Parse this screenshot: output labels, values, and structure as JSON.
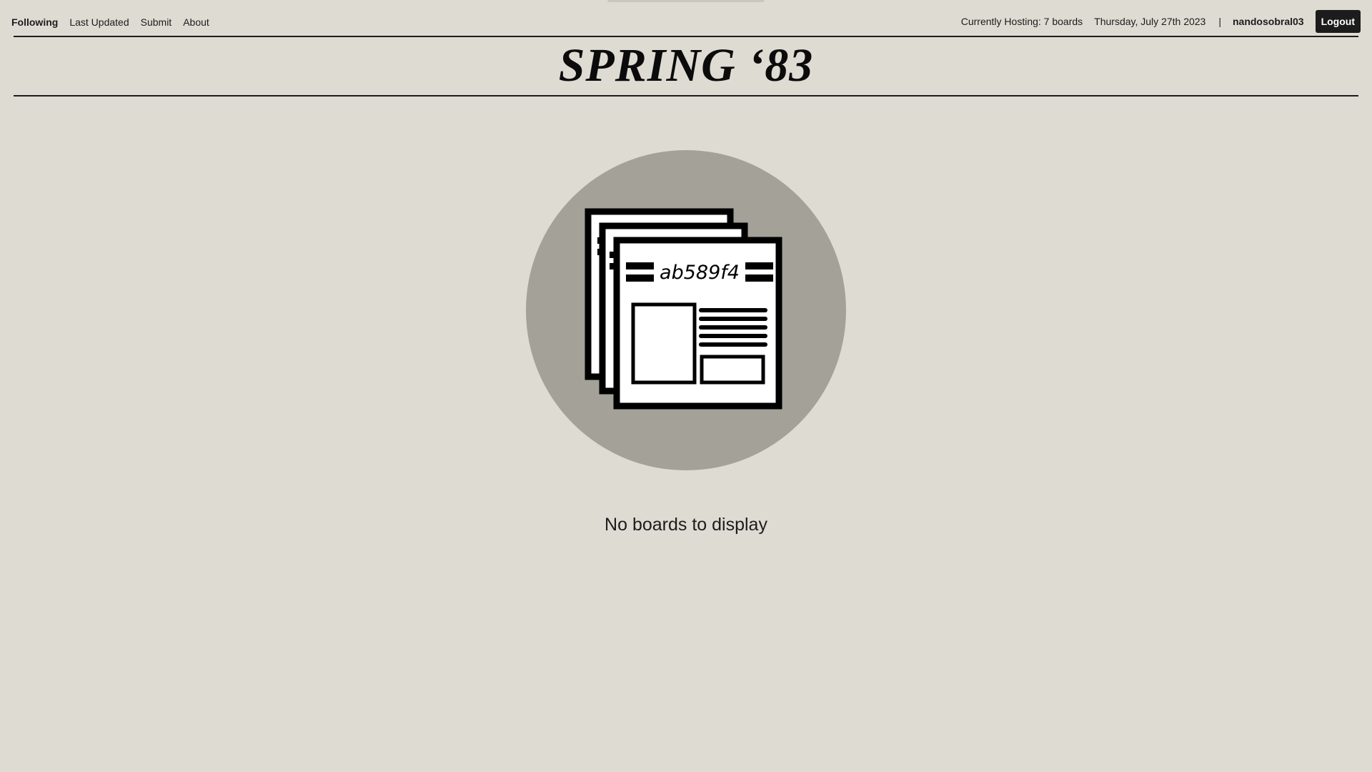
{
  "nav": {
    "following": "Following",
    "last_updated": "Last Updated",
    "submit": "Submit",
    "about": "About"
  },
  "status": {
    "hosting": "Currently Hosting: 7 boards",
    "date": "Thursday, July 27th 2023",
    "separator": "|",
    "username": "nandosobral03",
    "logout": "Logout"
  },
  "header": {
    "title": "SPRING ‘83"
  },
  "empty_state": {
    "board_key": "ab589f4",
    "message": "No boards to display",
    "icon": "newspaper-stack-icon"
  },
  "colors": {
    "background": "#dedbd3",
    "ink": "#1c1c1c",
    "circle": "#a4a199"
  }
}
